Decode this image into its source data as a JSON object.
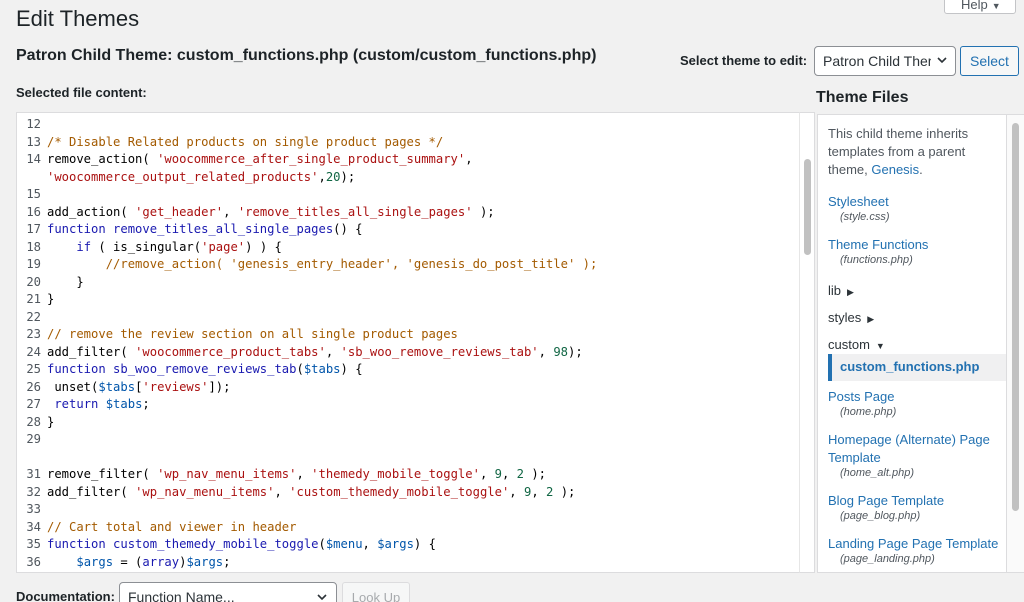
{
  "header": {
    "title": "Edit Themes",
    "help_label": "Help",
    "file_heading": "Patron Child Theme: custom_functions.php (custom/custom_functions.php)",
    "theme_select_label": "Select theme to edit:",
    "theme_select_value": "Patron Child Theme",
    "select_button": "Select",
    "selected_file_label": "Selected file content:"
  },
  "editor": {
    "lines": [
      {
        "n": "12",
        "tokens": []
      },
      {
        "n": "13",
        "tokens": [
          {
            "t": "/* Disable Related products on single product pages */",
            "c": "cmt"
          }
        ]
      },
      {
        "n": "14",
        "tokens": [
          {
            "t": "remove_action( ",
            "c": "txt"
          },
          {
            "t": "'woocommerce_after_single_product_summary'",
            "c": "str"
          },
          {
            "t": ",",
            "c": "txt"
          }
        ]
      },
      {
        "n": "",
        "tokens": [
          {
            "t": "'woocommerce_output_related_products'",
            "c": "str"
          },
          {
            "t": ",",
            "c": "txt"
          },
          {
            "t": "20",
            "c": "num"
          },
          {
            "t": ");",
            "c": "txt"
          }
        ]
      },
      {
        "n": "15",
        "tokens": []
      },
      {
        "n": "16",
        "tokens": [
          {
            "t": "add_action( ",
            "c": "txt"
          },
          {
            "t": "'get_header'",
            "c": "str"
          },
          {
            "t": ", ",
            "c": "txt"
          },
          {
            "t": "'remove_titles_all_single_pages'",
            "c": "str"
          },
          {
            "t": " );",
            "c": "txt"
          }
        ]
      },
      {
        "n": "17",
        "tokens": [
          {
            "t": "function ",
            "c": "kw"
          },
          {
            "t": "remove_titles_all_single_pages",
            "c": "kw"
          },
          {
            "t": "() {",
            "c": "txt"
          }
        ]
      },
      {
        "n": "18",
        "tokens": [
          {
            "t": "    ",
            "c": "txt"
          },
          {
            "t": "if",
            "c": "kw"
          },
          {
            "t": " ( is_singular(",
            "c": "txt"
          },
          {
            "t": "'page'",
            "c": "str"
          },
          {
            "t": ") ) {",
            "c": "txt"
          }
        ]
      },
      {
        "n": "19",
        "tokens": [
          {
            "t": "        //remove_action( 'genesis_entry_header', 'genesis_do_post_title' );",
            "c": "cmt"
          }
        ]
      },
      {
        "n": "20",
        "tokens": [
          {
            "t": "    }",
            "c": "txt"
          }
        ]
      },
      {
        "n": "21",
        "tokens": [
          {
            "t": "}",
            "c": "txt"
          }
        ]
      },
      {
        "n": "22",
        "tokens": []
      },
      {
        "n": "23",
        "tokens": [
          {
            "t": "// remove the review section on all single product pages",
            "c": "cmt"
          }
        ]
      },
      {
        "n": "24",
        "tokens": [
          {
            "t": "add_filter( ",
            "c": "txt"
          },
          {
            "t": "'woocommerce_product_tabs'",
            "c": "str"
          },
          {
            "t": ", ",
            "c": "txt"
          },
          {
            "t": "'sb_woo_remove_reviews_tab'",
            "c": "str"
          },
          {
            "t": ", ",
            "c": "txt"
          },
          {
            "t": "98",
            "c": "num"
          },
          {
            "t": ");",
            "c": "txt"
          }
        ]
      },
      {
        "n": "25",
        "tokens": [
          {
            "t": "function ",
            "c": "kw"
          },
          {
            "t": "sb_woo_remove_reviews_tab",
            "c": "kw"
          },
          {
            "t": "(",
            "c": "txt"
          },
          {
            "t": "$tabs",
            "c": "var"
          },
          {
            "t": ") {",
            "c": "txt"
          }
        ]
      },
      {
        "n": "26",
        "tokens": [
          {
            "t": " unset(",
            "c": "txt"
          },
          {
            "t": "$tabs",
            "c": "var"
          },
          {
            "t": "[",
            "c": "txt"
          },
          {
            "t": "'reviews'",
            "c": "str"
          },
          {
            "t": "]);",
            "c": "txt"
          }
        ]
      },
      {
        "n": "27",
        "tokens": [
          {
            "t": " ",
            "c": "txt"
          },
          {
            "t": "return",
            "c": "kw"
          },
          {
            "t": " ",
            "c": "txt"
          },
          {
            "t": "$tabs",
            "c": "var"
          },
          {
            "t": ";",
            "c": "txt"
          }
        ]
      },
      {
        "n": "28",
        "tokens": [
          {
            "t": "}",
            "c": "txt"
          }
        ]
      },
      {
        "n": "29",
        "tokens": []
      },
      {
        "n": "",
        "tokens": []
      },
      {
        "n": "31",
        "tokens": [
          {
            "t": "remove_filter( ",
            "c": "txt"
          },
          {
            "t": "'wp_nav_menu_items'",
            "c": "str"
          },
          {
            "t": ", ",
            "c": "txt"
          },
          {
            "t": "'themedy_mobile_toggle'",
            "c": "str"
          },
          {
            "t": ", ",
            "c": "txt"
          },
          {
            "t": "9",
            "c": "num"
          },
          {
            "t": ", ",
            "c": "txt"
          },
          {
            "t": "2",
            "c": "num"
          },
          {
            "t": " );",
            "c": "txt"
          }
        ]
      },
      {
        "n": "32",
        "tokens": [
          {
            "t": "add_filter( ",
            "c": "txt"
          },
          {
            "t": "'wp_nav_menu_items'",
            "c": "str"
          },
          {
            "t": ", ",
            "c": "txt"
          },
          {
            "t": "'custom_themedy_mobile_toggle'",
            "c": "str"
          },
          {
            "t": ", ",
            "c": "txt"
          },
          {
            "t": "9",
            "c": "num"
          },
          {
            "t": ", ",
            "c": "txt"
          },
          {
            "t": "2",
            "c": "num"
          },
          {
            "t": " );",
            "c": "txt"
          }
        ]
      },
      {
        "n": "33",
        "tokens": []
      },
      {
        "n": "34",
        "tokens": [
          {
            "t": "// Cart total and viewer in header",
            "c": "cmt"
          }
        ]
      },
      {
        "n": "35",
        "tokens": [
          {
            "t": "function ",
            "c": "kw"
          },
          {
            "t": "custom_themedy_mobile_toggle",
            "c": "kw"
          },
          {
            "t": "(",
            "c": "txt"
          },
          {
            "t": "$menu",
            "c": "var"
          },
          {
            "t": ", ",
            "c": "txt"
          },
          {
            "t": "$args",
            "c": "var"
          },
          {
            "t": ") {",
            "c": "txt"
          }
        ]
      },
      {
        "n": "36",
        "tokens": [
          {
            "t": "    ",
            "c": "txt"
          },
          {
            "t": "$args",
            "c": "var"
          },
          {
            "t": " = (",
            "c": "txt"
          },
          {
            "t": "array",
            "c": "kw"
          },
          {
            "t": ")",
            "c": "txt"
          },
          {
            "t": "$args",
            "c": "var"
          },
          {
            "t": ";",
            "c": "txt"
          }
        ]
      }
    ]
  },
  "sidebar": {
    "title": "Theme Files",
    "desc_text": "This child theme inherits templates from a parent theme,",
    "desc_link": "Genesis",
    "desc_end": ".",
    "items": [
      {
        "label": "Stylesheet",
        "file": "(style.css)"
      },
      {
        "label": "Theme Functions",
        "file": "(functions.php)"
      }
    ],
    "dirs": [
      {
        "label": "lib",
        "arrow": "▶"
      },
      {
        "label": "styles",
        "arrow": "▶"
      },
      {
        "label": "custom",
        "arrow": "▼"
      }
    ],
    "active_file": "custom_functions.php",
    "templates": [
      {
        "label": "Posts Page",
        "file": "(home.php)"
      },
      {
        "label": "Homepage (Alternate) Page Template",
        "file": "(home_alt.php)"
      },
      {
        "label": "Blog Page Template",
        "file": "(page_blog.php)"
      },
      {
        "label": "Landing Page Page Template",
        "file": "(page_landing.php)"
      }
    ]
  },
  "footer": {
    "doc_label": "Documentation:",
    "doc_placeholder": "Function Name...",
    "lookup_button": "Look Up"
  },
  "colors": {
    "link": "#2271b1",
    "comment": "#a35a00",
    "keyword": "#1a1ab0",
    "string": "#aa1111"
  }
}
